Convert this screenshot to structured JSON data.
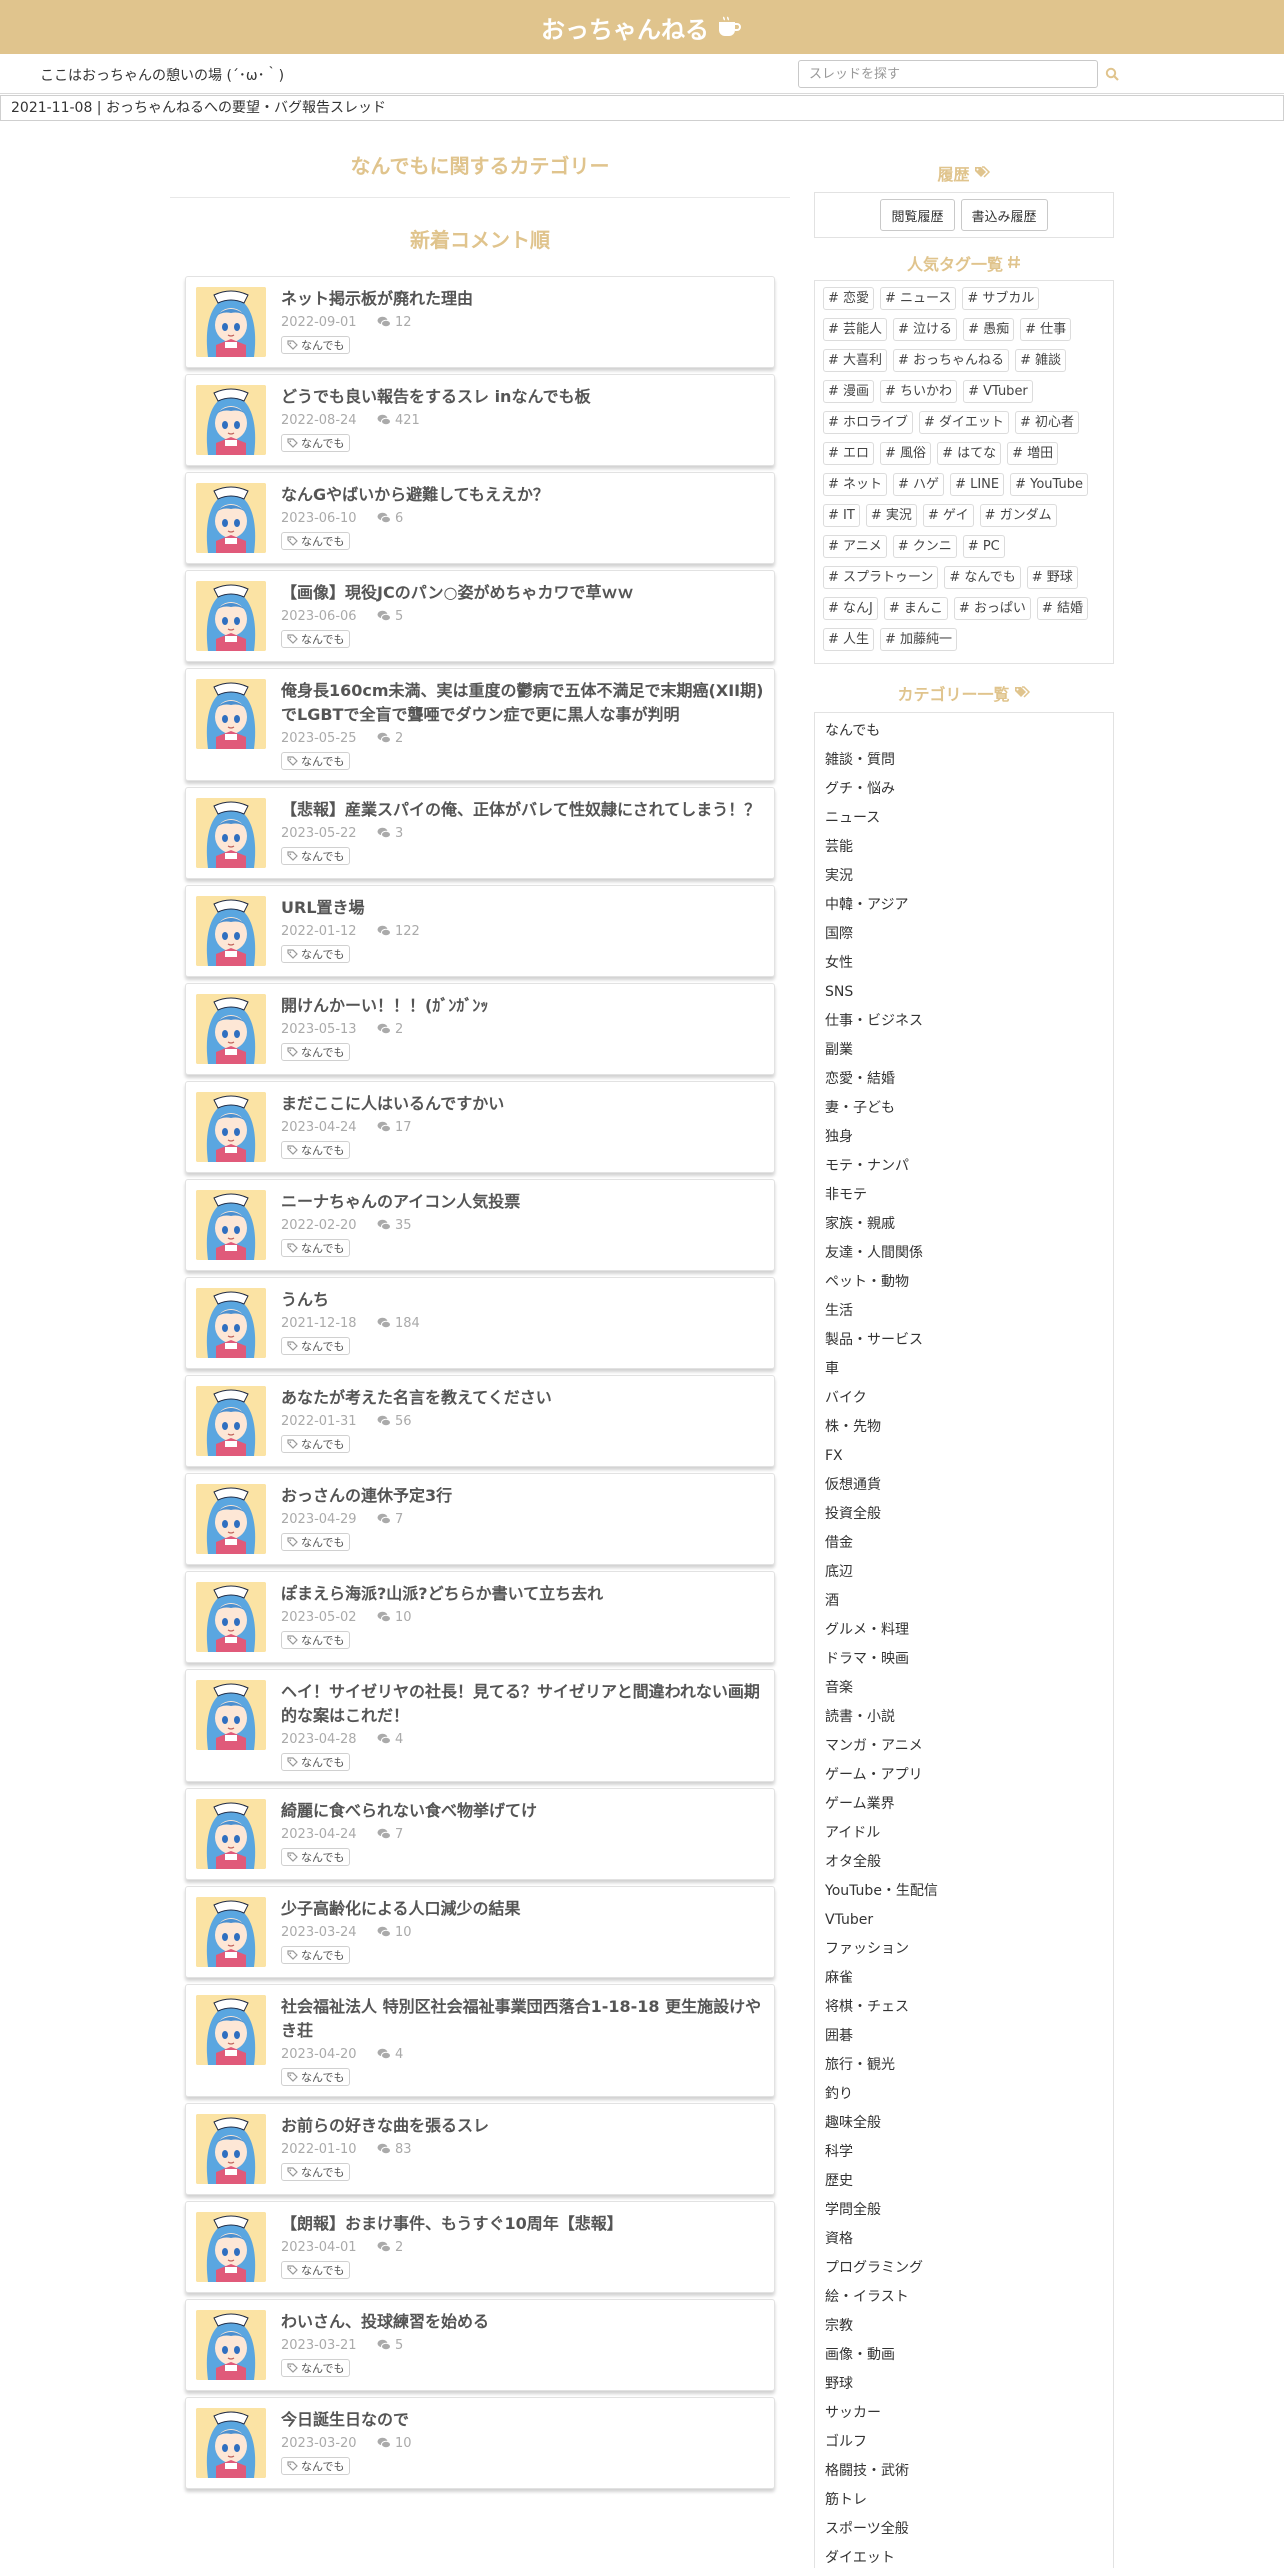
{
  "header": {
    "title": "おっちゃんねる"
  },
  "subbar": {
    "tagline": "ここはおっちゃんの憩いの場 (´･ω･｀)",
    "search_placeholder": "スレッドを探す"
  },
  "announcement": "2021-11-08 | おっちゃんねるへの要望・バグ報告スレッド",
  "main": {
    "category_title": "なんでもに関するカテゴリー",
    "sort_title": "新着コメント順",
    "threads": [
      {
        "title": "ネット掲示板が廃れた理由",
        "date": "2022-09-01",
        "comments": "12",
        "tag": "なんでも"
      },
      {
        "title": "どうでも良い報告をするスレ inなんでも板",
        "date": "2022-08-24",
        "comments": "421",
        "tag": "なんでも"
      },
      {
        "title": "なんGやばいから避難してもええか？",
        "date": "2023-06-10",
        "comments": "6",
        "tag": "なんでも"
      },
      {
        "title": "【画像】現役JCのパン○姿がめちゃカワで草ｗｗ",
        "date": "2023-06-06",
        "comments": "5",
        "tag": "なんでも"
      },
      {
        "title": "俺身長160cm未満、実は重度の鬱病で五体不満足で末期癌(XII期)でLGBTで全盲で聾唖でダウン症で更に黒人な事が判明",
        "date": "2023-05-25",
        "comments": "2",
        "tag": "なんでも"
      },
      {
        "title": "【悲報】産業スパイの俺、正体がバレて性奴隷にされてしまう！？",
        "date": "2023-05-22",
        "comments": "3",
        "tag": "なんでも"
      },
      {
        "title": "URL置き場",
        "date": "2022-01-12",
        "comments": "122",
        "tag": "なんでも"
      },
      {
        "title": "開けんかーい！！！(ｶﾞﾝｶﾞﾝｯ",
        "date": "2023-05-13",
        "comments": "2",
        "tag": "なんでも"
      },
      {
        "title": "まだここに人はいるんですかい",
        "date": "2023-04-24",
        "comments": "17",
        "tag": "なんでも"
      },
      {
        "title": "ニーナちゃんのアイコン人気投票",
        "date": "2022-02-20",
        "comments": "35",
        "tag": "なんでも"
      },
      {
        "title": "うんち",
        "date": "2021-12-18",
        "comments": "184",
        "tag": "なんでも"
      },
      {
        "title": "あなたが考えた名言を教えてください",
        "date": "2022-01-31",
        "comments": "56",
        "tag": "なんでも"
      },
      {
        "title": "おっさんの連休予定3行",
        "date": "2023-04-29",
        "comments": "7",
        "tag": "なんでも"
      },
      {
        "title": "ぽまえら海派?山派?どちらか書いて立ち去れ",
        "date": "2023-05-02",
        "comments": "10",
        "tag": "なんでも"
      },
      {
        "title": "ヘイ！サイゼリヤの社長！見てる？サイゼリアと間違われない画期的な案はこれだ！",
        "date": "2023-04-28",
        "comments": "4",
        "tag": "なんでも"
      },
      {
        "title": "綺麗に食べられない食べ物挙げてけ",
        "date": "2023-04-24",
        "comments": "7",
        "tag": "なんでも"
      },
      {
        "title": "少子高齢化による人口減少の結果",
        "date": "2023-03-24",
        "comments": "10",
        "tag": "なんでも"
      },
      {
        "title": "社会福祉法人 特別区社会福祉事業団西落合1-18-18 更生施設けやき荘",
        "date": "2023-04-20",
        "comments": "4",
        "tag": "なんでも"
      },
      {
        "title": "お前らの好きな曲を張るスレ",
        "date": "2022-01-10",
        "comments": "83",
        "tag": "なんでも"
      },
      {
        "title": "【朗報】おまけ事件、もうすぐ10周年【悲報】",
        "date": "2023-04-01",
        "comments": "2",
        "tag": "なんでも"
      },
      {
        "title": "わいさん、投球練習を始める",
        "date": "2023-03-21",
        "comments": "5",
        "tag": "なんでも"
      },
      {
        "title": "今日誕生日なので",
        "date": "2023-03-20",
        "comments": "10",
        "tag": "なんでも"
      }
    ]
  },
  "sidebar": {
    "history_title": "履歴",
    "history_buttons": [
      "閲覧履歴",
      "書込み履歴"
    ],
    "tags_title": "人気タグ一覧",
    "tags": [
      "# 恋愛",
      "# ニュース",
      "# サブカル",
      "# 芸能人",
      "# 泣ける",
      "# 愚痴",
      "# 仕事",
      "# 大喜利",
      "# おっちゃんねる",
      "# 雑談",
      "# 漫画",
      "# ちいかわ",
      "# VTuber",
      "# ホロライブ",
      "# ダイエット",
      "# 初心者",
      "# エロ",
      "# 風俗",
      "# はてな",
      "# 増田",
      "# ネット",
      "# ハゲ",
      "# LINE",
      "# YouTube",
      "# IT",
      "# 実況",
      "# ゲイ",
      "# ガンダム",
      "# アニメ",
      "# クンニ",
      "# PC",
      "# スプラトゥーン",
      "# なんでも",
      "# 野球",
      "# なんJ",
      "# まんこ",
      "# おっぱい",
      "# 結婚",
      "# 人生",
      "# 加藤純一"
    ],
    "categories_title": "カテゴリー一覧",
    "categories": [
      "なんでも",
      "雑談・質問",
      "グチ・悩み",
      "ニュース",
      "芸能",
      "実況",
      "中韓・アジア",
      "国際",
      "女性",
      "SNS",
      "仕事・ビジネス",
      "副業",
      "恋愛・結婚",
      "妻・子ども",
      "独身",
      "モテ・ナンパ",
      "非モテ",
      "家族・親戚",
      "友達・人間関係",
      "ペット・動物",
      "生活",
      "製品・サービス",
      "車",
      "バイク",
      "株・先物",
      "FX",
      "仮想通貨",
      "投資全般",
      "借金",
      "底辺",
      "酒",
      "グルメ・料理",
      "ドラマ・映画",
      "音楽",
      "読書・小説",
      "マンガ・アニメ",
      "ゲーム・アプリ",
      "ゲーム業界",
      "アイドル",
      "オタ全般",
      "YouTube・生配信",
      "VTuber",
      "ファッション",
      "麻雀",
      "将棋・チェス",
      "囲碁",
      "旅行・観光",
      "釣り",
      "趣味全般",
      "科学",
      "歴史",
      "学問全般",
      "資格",
      "プログラミング",
      "絵・イラスト",
      "宗教",
      "画像・動画",
      "野球",
      "サッカー",
      "ゴルフ",
      "格闘技・武術",
      "筋トレ",
      "スポーツ全般",
      "ダイエット"
    ]
  }
}
